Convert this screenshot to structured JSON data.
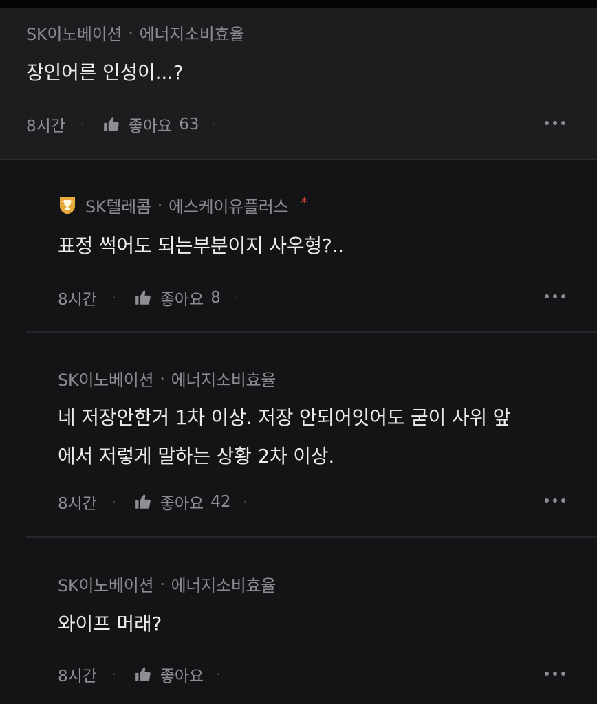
{
  "comments": [
    {
      "company": "SK이노베이션",
      "dept": "에너지소비효율",
      "text_lines": [
        "장인어른 인성이...?"
      ],
      "time": "8시간",
      "like_label": "좋아요",
      "like_count": "63"
    },
    {
      "company": "SK텔레콤",
      "dept": "에스케이유플러스",
      "star": "*",
      "text_lines": [
        "표정 썩어도 되는부분이지 사우형?.."
      ],
      "time": "8시간",
      "like_label": "좋아요",
      "like_count": "8"
    },
    {
      "company": "SK이노베이션",
      "dept": "에너지소비효율",
      "text_lines": [
        "네 저장안한거 1차 이상. 저장 안되어잇어도 굳이 사위 앞",
        "에서 저렇게 말하는 상황 2차 이상."
      ],
      "time": "8시간",
      "like_label": "좋아요",
      "like_count": "42"
    },
    {
      "company": "SK이노베이션",
      "dept": "에너지소비효율",
      "text_lines": [
        "와이프 머래?"
      ],
      "time": "8시간",
      "like_label": "좋아요",
      "like_count": ""
    }
  ],
  "separator": "·",
  "icons": {
    "like": "thumbs-up-icon",
    "more": "more-horizontal-icon",
    "badge": "trophy-badge-icon"
  },
  "colors": {
    "star": "#e0443a",
    "badge": "#e7a93a"
  }
}
